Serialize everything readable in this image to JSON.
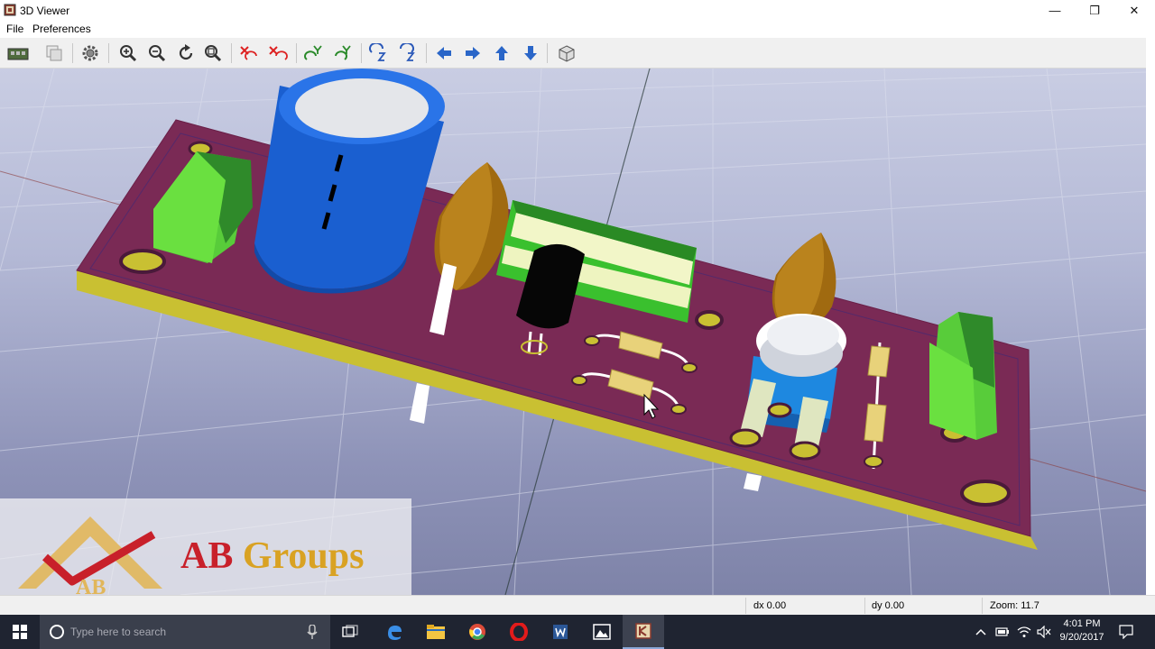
{
  "window": {
    "title": "3D Viewer",
    "controls": {
      "minimize": "—",
      "maximize": "❐",
      "close": "✕"
    }
  },
  "menu": {
    "items": [
      "File",
      "Preferences"
    ]
  },
  "toolbar": {
    "buttons": [
      "reload-board-icon",
      "copy-image-icon",
      "settings-icon",
      "zoom-in-icon",
      "zoom-out-icon",
      "redraw-icon",
      "zoom-fit-icon",
      "rotate-x-cw-icon",
      "rotate-x-ccw-icon",
      "rotate-y-cw-icon",
      "rotate-y-ccw-icon",
      "rotate-z-cw-icon",
      "rotate-z-ccw-icon",
      "move-left-icon",
      "move-right-icon",
      "move-up-icon",
      "move-down-icon",
      "ortho-view-icon"
    ]
  },
  "viewer": {
    "background_top": "#c9cde3",
    "background_bottom": "#7e83a8",
    "board_color": "#7a2a55",
    "board_edge_color": "#c9c032"
  },
  "watermark": {
    "brand_ab": "AB",
    "brand_groups": "Groups",
    "logo_text": "AB",
    "ab_color": "#c8202a",
    "groups_color": "#d9a223"
  },
  "status": {
    "dx": "dx 0.00",
    "dy": "dy 0.00",
    "zoom": "Zoom: 11.7"
  },
  "taskbar": {
    "search_placeholder": "Type here to search",
    "time": "4:01 PM",
    "date": "9/20/2017"
  }
}
